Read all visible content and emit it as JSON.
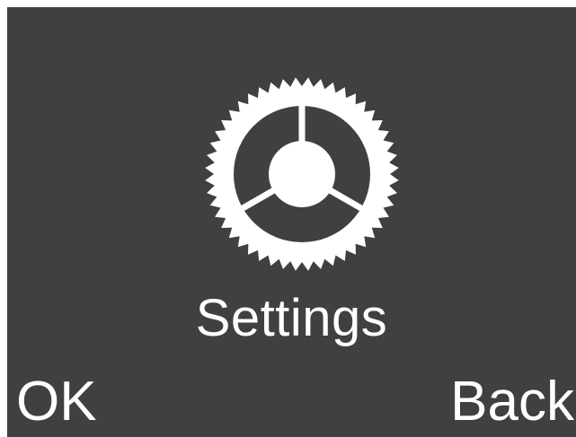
{
  "screen": {
    "background_color": "#404040",
    "foreground_color": "#ffffff"
  },
  "menu": {
    "icon": "gear-icon",
    "title": "Settings"
  },
  "softkeys": {
    "left_label": "OK",
    "right_label": "Back"
  }
}
